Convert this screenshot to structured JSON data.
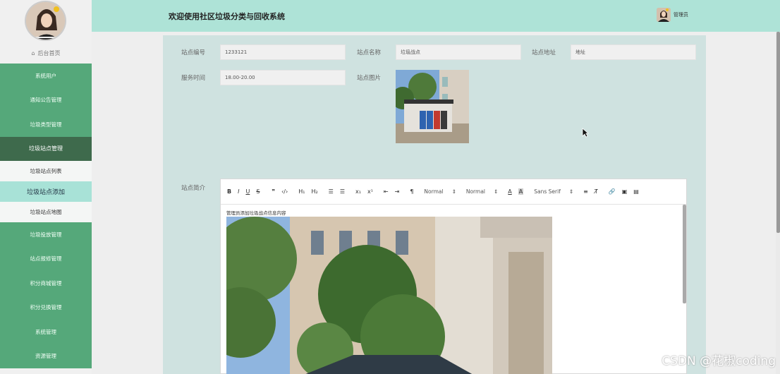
{
  "header": {
    "title": "欢迎使用社区垃圾分类与回收系统",
    "user": "管理员"
  },
  "sidebar": {
    "home": "后台首页",
    "items": [
      {
        "label": "系统用户"
      },
      {
        "label": "通知公告管理"
      },
      {
        "label": "垃圾类型管理"
      },
      {
        "label": "垃圾站点管理"
      },
      {
        "label": "垃圾站点列表"
      },
      {
        "label": "垃圾站点添加"
      },
      {
        "label": "垃圾站点地图"
      },
      {
        "label": "垃圾投放管理"
      },
      {
        "label": "站点报修管理"
      },
      {
        "label": "积分商城管理"
      },
      {
        "label": "积分兑换管理"
      },
      {
        "label": "系统管理"
      },
      {
        "label": "资源管理"
      }
    ]
  },
  "form": {
    "station_no_label": "站点编号",
    "station_no_value": "1233121",
    "station_name_label": "站点名称",
    "station_name_value": "垃圾战点",
    "station_addr_label": "站点地址",
    "station_addr_value": "地址",
    "service_time_label": "服务时间",
    "service_time_value": "18.00-20.00",
    "station_img_label": "站点图片",
    "intro_label": "站点简介"
  },
  "editor": {
    "header_select_1": "Normal",
    "header_select_2": "Normal",
    "font_select": "Sans Serif",
    "content_text": "管理员添加垃圾战点信息内容"
  },
  "watermark": "CSDN @花椒coding"
}
